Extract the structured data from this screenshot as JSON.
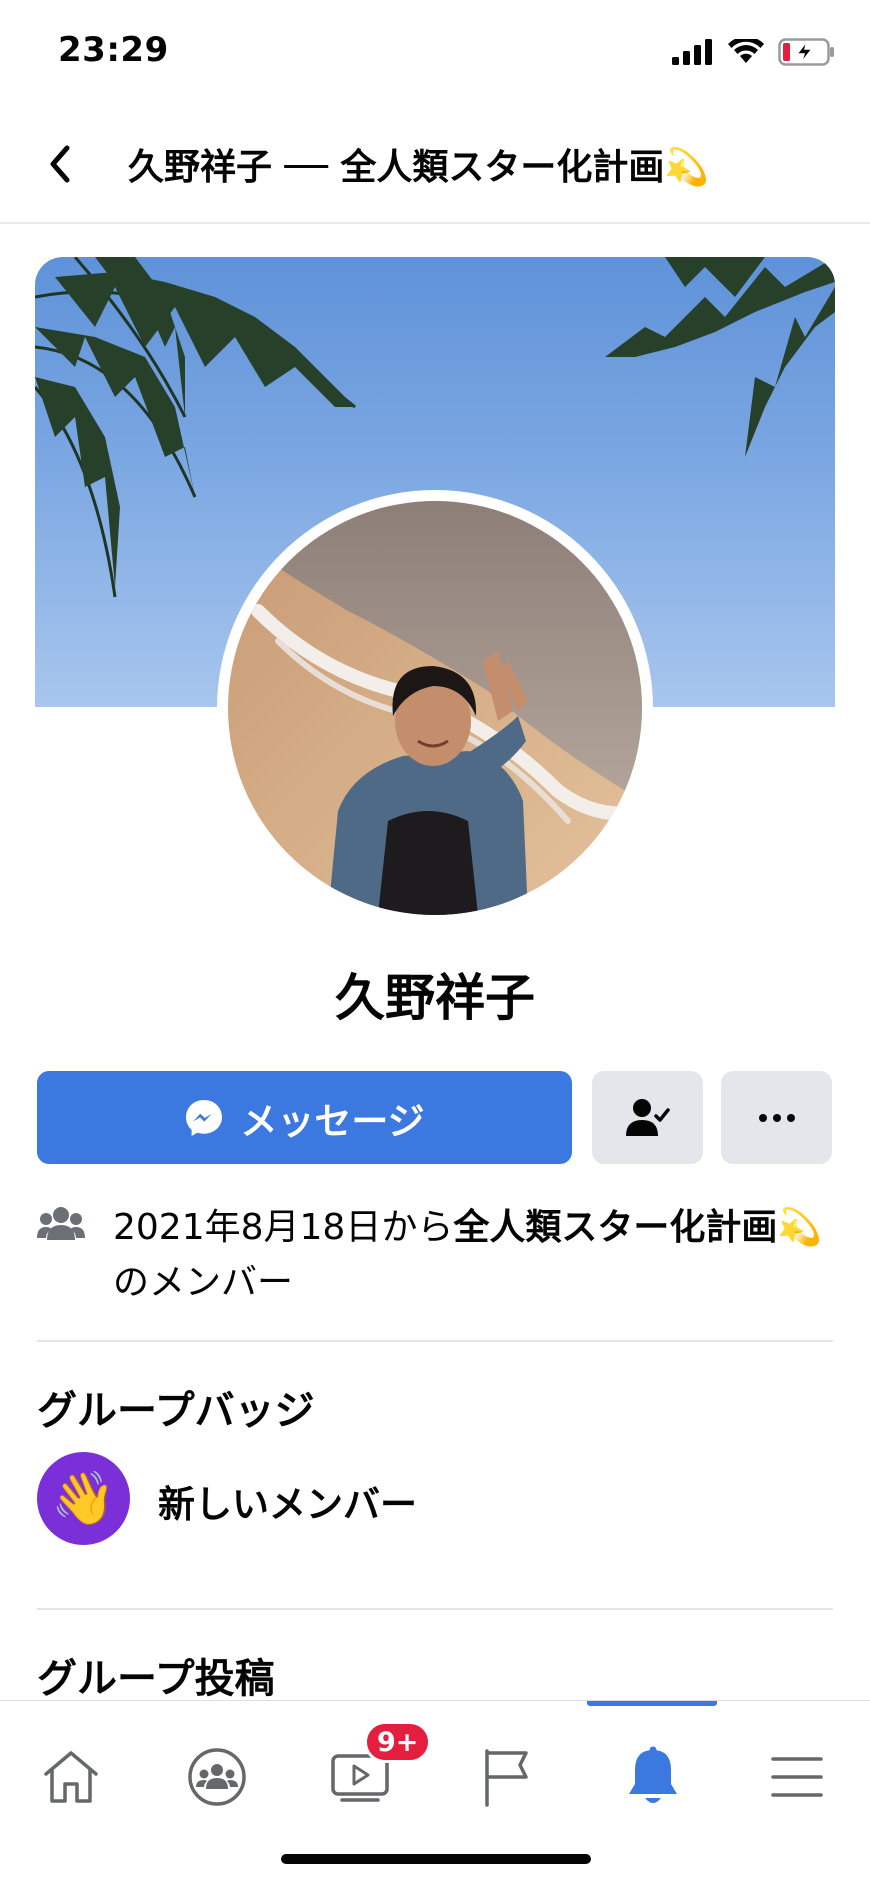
{
  "status_bar": {
    "time": "23:29"
  },
  "header": {
    "title": "久野祥子 ── 全人類スター化計画💫"
  },
  "profile": {
    "name": "久野祥子"
  },
  "actions": {
    "message_label": "メッセージ"
  },
  "membership": {
    "prefix": "2021年8月18日から",
    "group_name": "全人類スター化計画💫",
    "suffix": "のメンバー"
  },
  "badges_section": {
    "title": "グループバッジ",
    "badge_label": "新しいメンバー",
    "badge_emoji": "👋"
  },
  "posts_section": {
    "title": "グループ投稿"
  },
  "tab_bar": {
    "tabs": [
      "home-icon",
      "groups-icon",
      "watch-icon",
      "pages-flag-icon",
      "notifications-bell-icon",
      "menu-icon"
    ],
    "active_tab": "notifications-bell-icon",
    "watch_badge": "9+"
  },
  "colors": {
    "accent": "#3b78e0",
    "badge_red": "#e41e3f",
    "badge_purple": "#7b2fd9"
  }
}
